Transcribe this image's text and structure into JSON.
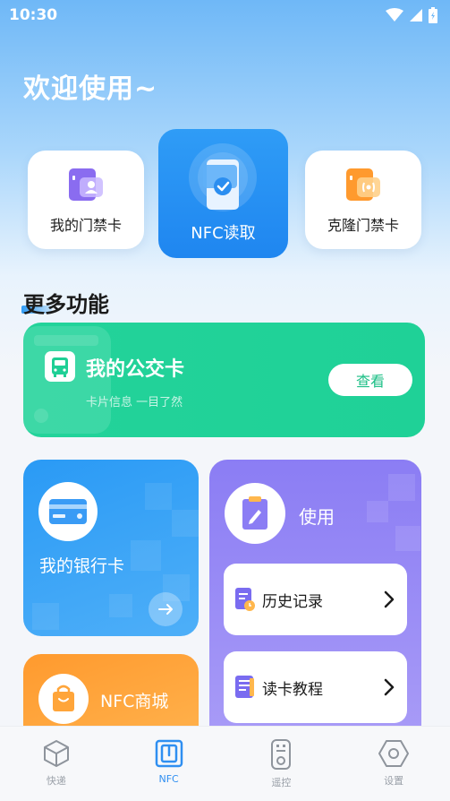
{
  "status": {
    "time": "10:30"
  },
  "header": {
    "welcome": "欢迎使用~"
  },
  "quick_cards": {
    "my_access_card": "我的门禁卡",
    "nfc_read": "NFC读取",
    "clone_access_card": "克隆门禁卡"
  },
  "more": {
    "title": "更多功能",
    "bus_card": {
      "title": "我的公交卡",
      "subtitle": "卡片信息 一目了然",
      "button": "查看"
    },
    "bank_card": {
      "title": "我的银行卡"
    },
    "shop": {
      "title": "NFC商城"
    },
    "use": {
      "title": "使用",
      "items": [
        {
          "label": "历史记录"
        },
        {
          "label": "读卡教程"
        }
      ]
    }
  },
  "tabs": [
    {
      "label": "快递",
      "icon": "cube-icon",
      "active": false
    },
    {
      "label": "NFC",
      "icon": "nfc-icon",
      "active": true
    },
    {
      "label": "遥控",
      "icon": "remote-icon",
      "active": false
    },
    {
      "label": "设置",
      "icon": "hexagon-settings-icon",
      "active": false
    }
  ],
  "colors": {
    "primary": "#2f9cf6",
    "bus_green": "#23d39a",
    "shop_orange": "#ff9a2e",
    "use_purple": "#8b7df4",
    "tab_active": "#2f8ff1"
  }
}
